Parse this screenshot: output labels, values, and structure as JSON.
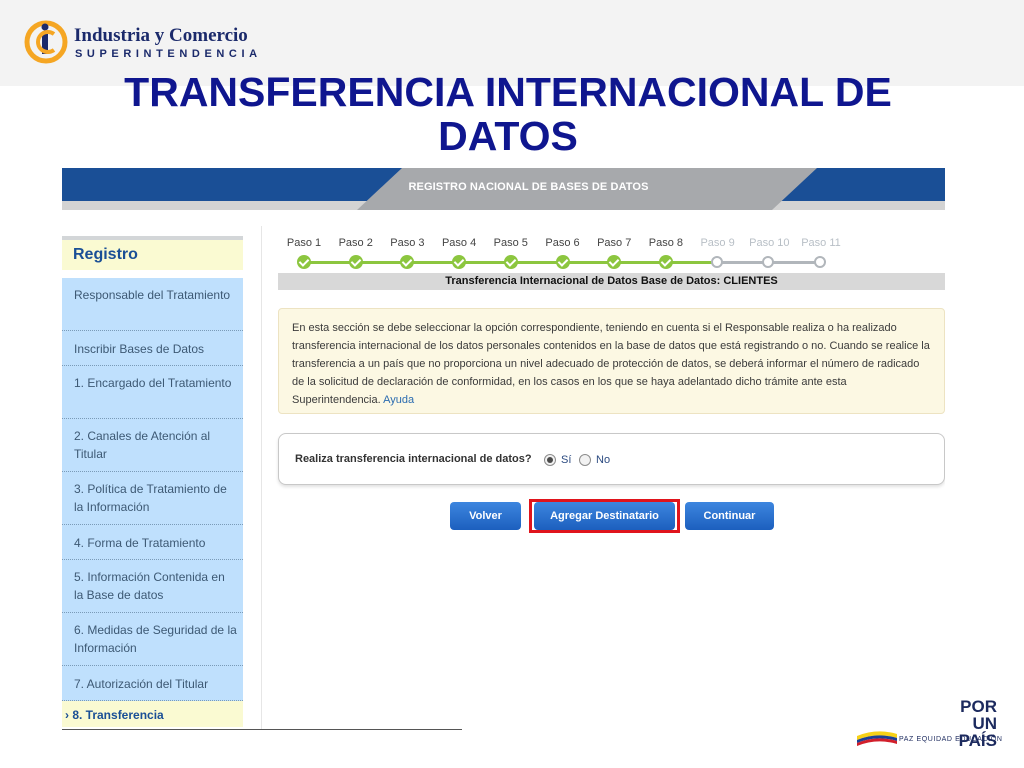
{
  "logo": {
    "title": "Industria y Comercio",
    "subtitle": "SUPERINTENDENCIA",
    "icon": "sic-logo-icon"
  },
  "slide": {
    "title": "TRANSFERENCIA INTERNACIONAL DE DATOS"
  },
  "banner": {
    "title": "REGISTRO NACIONAL DE BASES DE DATOS"
  },
  "sidebar": {
    "heading": "Registro",
    "items": [
      "Responsable del Tratamiento",
      "Inscribir Bases de Datos",
      "1. Encargado del Tratamiento",
      "2. Canales de Atención al Titular",
      "3. Política de Tratamiento de la Información",
      "4. Forma de Tratamiento",
      "5. Información Contenida en la Base de datos",
      "6. Medidas de Seguridad de la Información",
      "7. Autorización del Titular"
    ],
    "active_item": "› 8. Transferencia"
  },
  "steps": {
    "labels": [
      "Paso 1",
      "Paso 2",
      "Paso 3",
      "Paso 4",
      "Paso 5",
      "Paso 6",
      "Paso 7",
      "Paso 8",
      "Paso 9",
      "Paso 10",
      "Paso 11"
    ],
    "completed": 8,
    "colors": {
      "done": "#8cc63f",
      "pending": "#b1b6bb"
    }
  },
  "form": {
    "bar_title": "Transferencia Internacional de Datos Base de Datos: CLIENTES",
    "info_text": "En esta sección se debe seleccionar la opción correspondiente, teniendo en cuenta si el Responsable realiza o ha realizado transferencia internacional de los datos personales contenidos en la base de datos que está registrando o no. Cuando se realice la transferencia a un país que no proporciona un nivel adecuado de protección de datos, se deberá informar el número de radicado de la solicitud de declaración de conformidad, en los casos en los que se haya adelantado dicho trámite ante esta Superintendencia.",
    "help_link": "Ayuda",
    "question": "Realiza transferencia internacional de datos?",
    "options": [
      "Sí",
      "No"
    ],
    "selected": "Sí"
  },
  "buttons": {
    "back": "Volver",
    "add_recipient": "Agregar Destinatario",
    "continue": "Continuar"
  },
  "footer": {
    "brand_main": "POR UN PAÍS",
    "brand_tagline": "PAZ  EQUIDAD  EDUCACIÓN",
    "brand_icon": "flag-icon"
  }
}
